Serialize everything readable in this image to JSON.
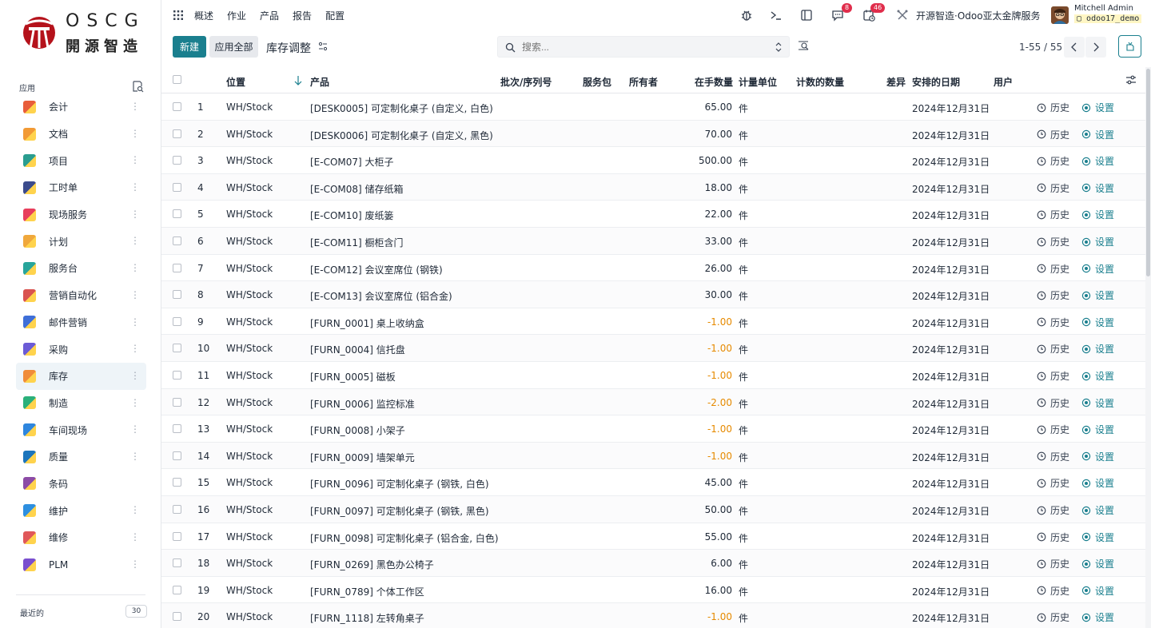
{
  "brand": {
    "name_top": "OSCG",
    "name_bottom": "開源智造"
  },
  "sidebar": {
    "apps_label": "应用",
    "recent_label": "最近的",
    "recent_count": "30",
    "items": [
      {
        "label": "会计",
        "color": "#e85d3a"
      },
      {
        "label": "文档",
        "color": "#f29a35"
      },
      {
        "label": "项目",
        "color": "#2a9d8f"
      },
      {
        "label": "工时单",
        "color": "#3b4b8c"
      },
      {
        "label": "现场服务",
        "color": "#e83e5c"
      },
      {
        "label": "计划",
        "color": "#f0a83c"
      },
      {
        "label": "服务台",
        "color": "#27a59b"
      },
      {
        "label": "营销自动化",
        "color": "#d9534f"
      },
      {
        "label": "邮件营销",
        "color": "#3f6fd8"
      },
      {
        "label": "采购",
        "color": "#6b5bd6"
      },
      {
        "label": "库存",
        "color": "#f08c3a"
      },
      {
        "label": "制造",
        "color": "#2bb07a"
      },
      {
        "label": "车间现场",
        "color": "#2e86de"
      },
      {
        "label": "质量",
        "color": "#1c75bc"
      },
      {
        "label": "条码",
        "color": "#8c4ba6"
      },
      {
        "label": "维护",
        "color": "#2d8fe0"
      },
      {
        "label": "维修",
        "color": "#e0585a"
      },
      {
        "label": "PLM",
        "color": "#7a4fcf"
      }
    ],
    "active_index": 10
  },
  "topnav": {
    "menu": [
      "概述",
      "作业",
      "产品",
      "报告",
      "配置"
    ],
    "badge_messages": "8",
    "badge_activities": "46",
    "company": "开源智造·Odoo亚太金牌服务",
    "user_name": "Mitchell Admin",
    "db_name": "odoo17_demo"
  },
  "control": {
    "new_label": "新建",
    "apply_label": "应用全部",
    "title": "库存调整",
    "search_placeholder": "搜索...",
    "pager": "1-55 / 55"
  },
  "table": {
    "headers": {
      "location": "位置",
      "product": "产品",
      "lot": "批次/序列号",
      "package": "服务包",
      "owner": "所有者",
      "onhand": "在手数量",
      "uom": "计量单位",
      "counted": "计数的数量",
      "diff": "差异",
      "date": "安排的日期",
      "user": "用户"
    },
    "history_label": "历史",
    "set_label": "设置",
    "rows": [
      {
        "n": "1",
        "loc": "WH/Stock",
        "product": "[DESK0005] 可定制化桌子 (自定义, 白色)",
        "qty": "65.00",
        "neg": false,
        "uom": "件",
        "date": "2024年12月31日"
      },
      {
        "n": "2",
        "loc": "WH/Stock",
        "product": "[DESK0006] 可定制化桌子 (自定义, 黑色)",
        "qty": "70.00",
        "neg": false,
        "uom": "件",
        "date": "2024年12月31日"
      },
      {
        "n": "3",
        "loc": "WH/Stock",
        "product": "[E-COM07] 大柜子",
        "qty": "500.00",
        "neg": false,
        "uom": "件",
        "date": "2024年12月31日"
      },
      {
        "n": "4",
        "loc": "WH/Stock",
        "product": "[E-COM08] 储存纸箱",
        "qty": "18.00",
        "neg": false,
        "uom": "件",
        "date": "2024年12月31日"
      },
      {
        "n": "5",
        "loc": "WH/Stock",
        "product": "[E-COM10] 废纸篓",
        "qty": "22.00",
        "neg": false,
        "uom": "件",
        "date": "2024年12月31日"
      },
      {
        "n": "6",
        "loc": "WH/Stock",
        "product": "[E-COM11] 橱柜含门",
        "qty": "33.00",
        "neg": false,
        "uom": "件",
        "date": "2024年12月31日"
      },
      {
        "n": "7",
        "loc": "WH/Stock",
        "product": "[E-COM12] 会议室席位 (钢铁)",
        "qty": "26.00",
        "neg": false,
        "uom": "件",
        "date": "2024年12月31日"
      },
      {
        "n": "8",
        "loc": "WH/Stock",
        "product": "[E-COM13] 会议室席位 (铝合金)",
        "qty": "30.00",
        "neg": false,
        "uom": "件",
        "date": "2024年12月31日"
      },
      {
        "n": "9",
        "loc": "WH/Stock",
        "product": "[FURN_0001] 桌上收纳盒",
        "qty": "-1.00",
        "neg": true,
        "uom": "件",
        "date": "2024年12月31日"
      },
      {
        "n": "10",
        "loc": "WH/Stock",
        "product": "[FURN_0004] 信托盘",
        "qty": "-1.00",
        "neg": true,
        "uom": "件",
        "date": "2024年12月31日"
      },
      {
        "n": "11",
        "loc": "WH/Stock",
        "product": "[FURN_0005] 磁板",
        "qty": "-1.00",
        "neg": true,
        "uom": "件",
        "date": "2024年12月31日"
      },
      {
        "n": "12",
        "loc": "WH/Stock",
        "product": "[FURN_0006] 监控标准",
        "qty": "-2.00",
        "neg": true,
        "uom": "件",
        "date": "2024年12月31日"
      },
      {
        "n": "13",
        "loc": "WH/Stock",
        "product": "[FURN_0008] 小架子",
        "qty": "-1.00",
        "neg": true,
        "uom": "件",
        "date": "2024年12月31日"
      },
      {
        "n": "14",
        "loc": "WH/Stock",
        "product": "[FURN_0009] 墙架单元",
        "qty": "-1.00",
        "neg": true,
        "uom": "件",
        "date": "2024年12月31日"
      },
      {
        "n": "15",
        "loc": "WH/Stock",
        "product": "[FURN_0096] 可定制化桌子 (钢铁, 白色)",
        "qty": "45.00",
        "neg": false,
        "uom": "件",
        "date": "2024年12月31日"
      },
      {
        "n": "16",
        "loc": "WH/Stock",
        "product": "[FURN_0097] 可定制化桌子 (钢铁, 黑色)",
        "qty": "50.00",
        "neg": false,
        "uom": "件",
        "date": "2024年12月31日"
      },
      {
        "n": "17",
        "loc": "WH/Stock",
        "product": "[FURN_0098] 可定制化桌子 (铝合金, 白色)",
        "qty": "55.00",
        "neg": false,
        "uom": "件",
        "date": "2024年12月31日"
      },
      {
        "n": "18",
        "loc": "WH/Stock",
        "product": "[FURN_0269] 黑色办公椅子",
        "qty": "6.00",
        "neg": false,
        "uom": "件",
        "date": "2024年12月31日"
      },
      {
        "n": "19",
        "loc": "WH/Stock",
        "product": "[FURN_0789] 个体工作区",
        "qty": "16.00",
        "neg": false,
        "uom": "件",
        "date": "2024年12月31日"
      },
      {
        "n": "20",
        "loc": "WH/Stock",
        "product": "[FURN_1118] 左转角桌子",
        "qty": "-1.00",
        "neg": true,
        "uom": "件",
        "date": "2024年12月31日"
      }
    ]
  },
  "colors": {
    "primary": "#1a7f8e",
    "negative": "#e68a00",
    "badge": "#e02d4b"
  }
}
